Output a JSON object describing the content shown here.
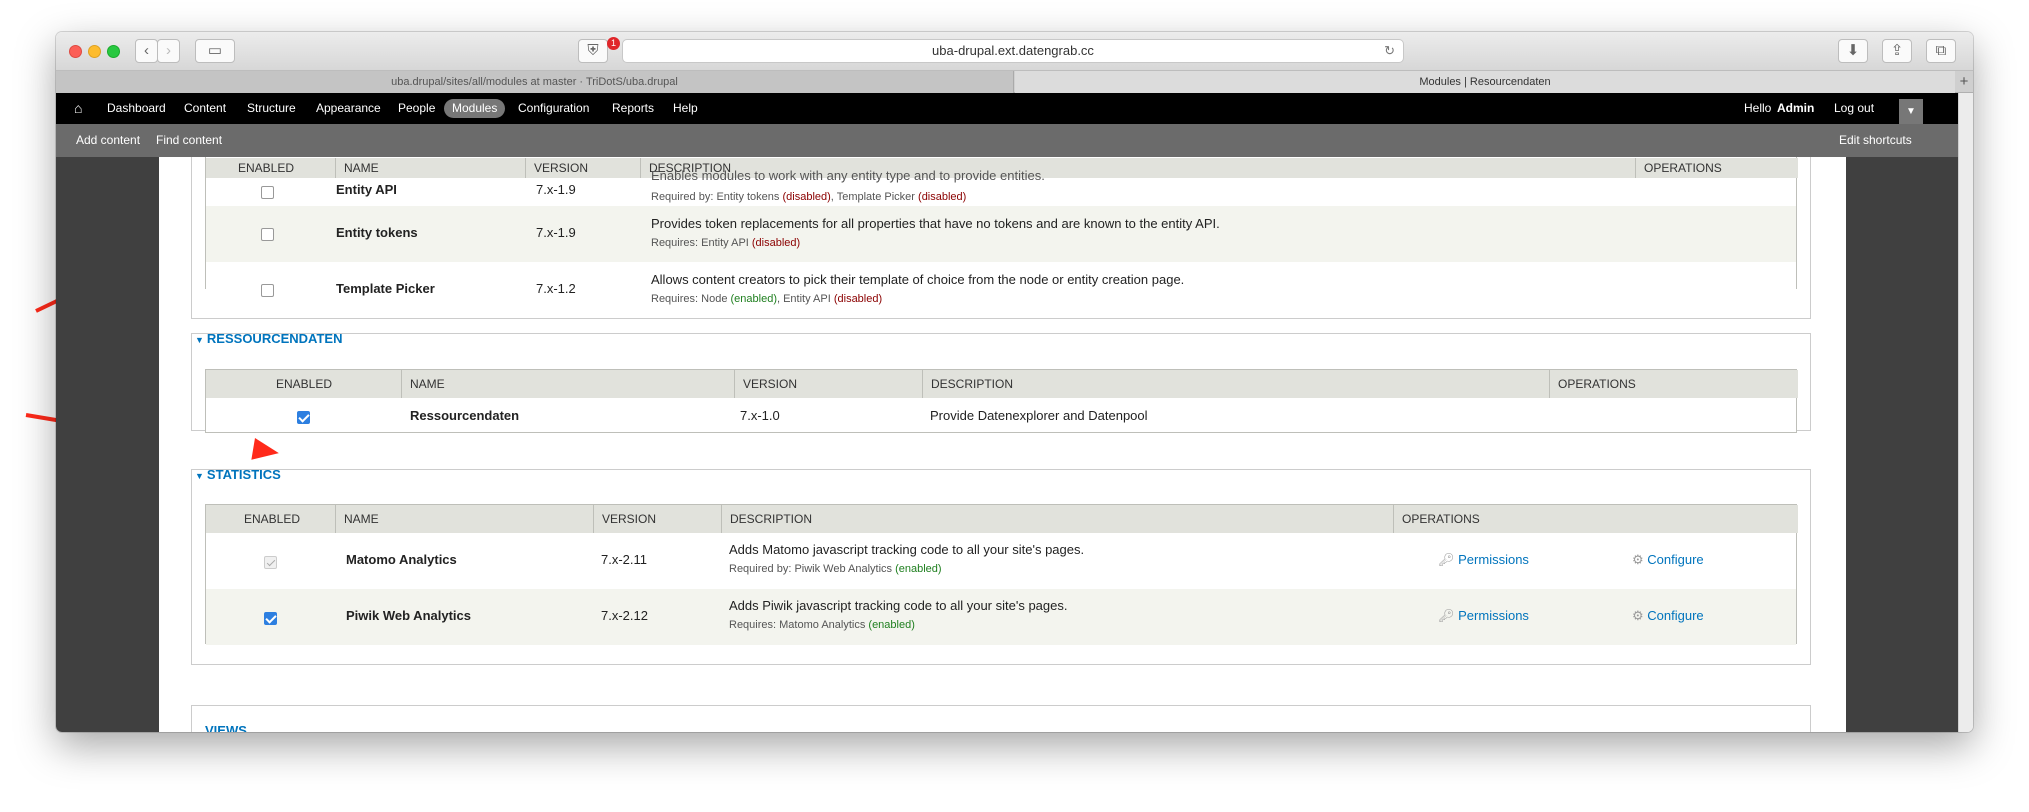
{
  "browser": {
    "url": "uba-drupal.ext.datengrab.cc",
    "shield_badge": "1",
    "tabs": [
      {
        "title": "uba.drupal/sites/all/modules at master · TriDotS/uba.drupal"
      },
      {
        "title": "Modules | Resourcendaten"
      }
    ]
  },
  "toolbar": {
    "items": [
      "Dashboard",
      "Content",
      "Structure",
      "Appearance",
      "People",
      "Modules",
      "Configuration",
      "Reports",
      "Help"
    ],
    "active": "Modules",
    "hello_prefix": "Hello",
    "user": "Admin",
    "logout": "Log out",
    "shortcuts": [
      "Add content",
      "Find content"
    ],
    "edit_shortcuts": "Edit shortcuts"
  },
  "table_headers": {
    "enabled": "ENABLED",
    "name": "NAME",
    "version": "VERSION",
    "description": "DESCRIPTION",
    "operations": "OPERATIONS"
  },
  "section_top": {
    "rows": [
      {
        "name": "Entity API",
        "version": "7.x-1.9",
        "desc": "Enables modules to work with any entity type and to provide entities.",
        "sub_label": "Required by:",
        "sub": [
          {
            "t": "Entity tokens ",
            "s": ""
          },
          {
            "t": "(disabled)",
            "s": "red"
          },
          {
            "t": ", Template Picker ",
            "s": ""
          },
          {
            "t": "(disabled)",
            "s": "red"
          }
        ],
        "checked": false
      },
      {
        "name": "Entity tokens",
        "version": "7.x-1.9",
        "desc": "Provides token replacements for all properties that have no tokens and are known to the entity API.",
        "sub_label": "Requires:",
        "sub": [
          {
            "t": "Entity API ",
            "s": ""
          },
          {
            "t": "(disabled)",
            "s": "red"
          }
        ],
        "checked": false
      },
      {
        "name": "Template Picker",
        "version": "7.x-1.2",
        "desc": "Allows content creators to pick their template of choice from the node or entity creation page.",
        "sub_label": "Requires:",
        "sub": [
          {
            "t": "Node ",
            "s": ""
          },
          {
            "t": "(enabled)",
            "s": "grn"
          },
          {
            "t": ", Entity API ",
            "s": ""
          },
          {
            "t": "(disabled)",
            "s": "red"
          }
        ],
        "checked": false
      }
    ]
  },
  "section_ress": {
    "title": "RESSOURCENDATEN",
    "rows": [
      {
        "name": "Ressourcendaten",
        "version": "7.x-1.0",
        "desc": "Provide Datenexplorer and Datenpool",
        "checked": true
      }
    ]
  },
  "section_stats": {
    "title": "STATISTICS",
    "rows": [
      {
        "name": "Matomo Analytics",
        "version": "7.x-2.11",
        "desc": "Adds Matomo javascript tracking code to all your site's pages.",
        "sub_label": "Required by:",
        "sub": [
          {
            "t": "Piwik Web Analytics ",
            "s": ""
          },
          {
            "t": "(enabled)",
            "s": "grn"
          }
        ],
        "checked": true,
        "locked": true,
        "permissions": "Permissions",
        "configure": "Configure"
      },
      {
        "name": "Piwik Web Analytics",
        "version": "7.x-2.12",
        "desc": "Adds Piwik javascript tracking code to all your site's pages.",
        "sub_label": "Requires:",
        "sub": [
          {
            "t": "Matomo Analytics ",
            "s": ""
          },
          {
            "t": "(enabled)",
            "s": "grn"
          }
        ],
        "checked": true,
        "locked": false,
        "permissions": "Permissions",
        "configure": "Configure"
      }
    ]
  },
  "section_next": {
    "title": "VIEWS"
  },
  "colors": {
    "link": "#0074bd",
    "arrow": "#ff2a1a",
    "toolbar": "#000000",
    "shortcuts": "#6b6b6b"
  }
}
